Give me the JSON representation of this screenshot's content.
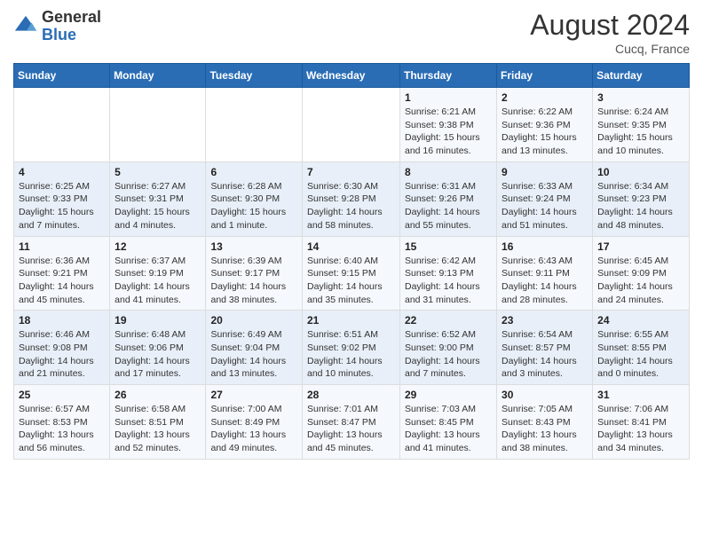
{
  "header": {
    "logo_general": "General",
    "logo_blue": "Blue",
    "month_title": "August 2024",
    "location": "Cucq, France"
  },
  "days_of_week": [
    "Sunday",
    "Monday",
    "Tuesday",
    "Wednesday",
    "Thursday",
    "Friday",
    "Saturday"
  ],
  "weeks": [
    [
      {
        "day": "",
        "info": ""
      },
      {
        "day": "",
        "info": ""
      },
      {
        "day": "",
        "info": ""
      },
      {
        "day": "",
        "info": ""
      },
      {
        "day": "1",
        "info": "Sunrise: 6:21 AM\nSunset: 9:38 PM\nDaylight: 15 hours and 16 minutes."
      },
      {
        "day": "2",
        "info": "Sunrise: 6:22 AM\nSunset: 9:36 PM\nDaylight: 15 hours and 13 minutes."
      },
      {
        "day": "3",
        "info": "Sunrise: 6:24 AM\nSunset: 9:35 PM\nDaylight: 15 hours and 10 minutes."
      }
    ],
    [
      {
        "day": "4",
        "info": "Sunrise: 6:25 AM\nSunset: 9:33 PM\nDaylight: 15 hours and 7 minutes."
      },
      {
        "day": "5",
        "info": "Sunrise: 6:27 AM\nSunset: 9:31 PM\nDaylight: 15 hours and 4 minutes."
      },
      {
        "day": "6",
        "info": "Sunrise: 6:28 AM\nSunset: 9:30 PM\nDaylight: 15 hours and 1 minute."
      },
      {
        "day": "7",
        "info": "Sunrise: 6:30 AM\nSunset: 9:28 PM\nDaylight: 14 hours and 58 minutes."
      },
      {
        "day": "8",
        "info": "Sunrise: 6:31 AM\nSunset: 9:26 PM\nDaylight: 14 hours and 55 minutes."
      },
      {
        "day": "9",
        "info": "Sunrise: 6:33 AM\nSunset: 9:24 PM\nDaylight: 14 hours and 51 minutes."
      },
      {
        "day": "10",
        "info": "Sunrise: 6:34 AM\nSunset: 9:23 PM\nDaylight: 14 hours and 48 minutes."
      }
    ],
    [
      {
        "day": "11",
        "info": "Sunrise: 6:36 AM\nSunset: 9:21 PM\nDaylight: 14 hours and 45 minutes."
      },
      {
        "day": "12",
        "info": "Sunrise: 6:37 AM\nSunset: 9:19 PM\nDaylight: 14 hours and 41 minutes."
      },
      {
        "day": "13",
        "info": "Sunrise: 6:39 AM\nSunset: 9:17 PM\nDaylight: 14 hours and 38 minutes."
      },
      {
        "day": "14",
        "info": "Sunrise: 6:40 AM\nSunset: 9:15 PM\nDaylight: 14 hours and 35 minutes."
      },
      {
        "day": "15",
        "info": "Sunrise: 6:42 AM\nSunset: 9:13 PM\nDaylight: 14 hours and 31 minutes."
      },
      {
        "day": "16",
        "info": "Sunrise: 6:43 AM\nSunset: 9:11 PM\nDaylight: 14 hours and 28 minutes."
      },
      {
        "day": "17",
        "info": "Sunrise: 6:45 AM\nSunset: 9:09 PM\nDaylight: 14 hours and 24 minutes."
      }
    ],
    [
      {
        "day": "18",
        "info": "Sunrise: 6:46 AM\nSunset: 9:08 PM\nDaylight: 14 hours and 21 minutes."
      },
      {
        "day": "19",
        "info": "Sunrise: 6:48 AM\nSunset: 9:06 PM\nDaylight: 14 hours and 17 minutes."
      },
      {
        "day": "20",
        "info": "Sunrise: 6:49 AM\nSunset: 9:04 PM\nDaylight: 14 hours and 13 minutes."
      },
      {
        "day": "21",
        "info": "Sunrise: 6:51 AM\nSunset: 9:02 PM\nDaylight: 14 hours and 10 minutes."
      },
      {
        "day": "22",
        "info": "Sunrise: 6:52 AM\nSunset: 9:00 PM\nDaylight: 14 hours and 7 minutes."
      },
      {
        "day": "23",
        "info": "Sunrise: 6:54 AM\nSunset: 8:57 PM\nDaylight: 14 hours and 3 minutes."
      },
      {
        "day": "24",
        "info": "Sunrise: 6:55 AM\nSunset: 8:55 PM\nDaylight: 14 hours and 0 minutes."
      }
    ],
    [
      {
        "day": "25",
        "info": "Sunrise: 6:57 AM\nSunset: 8:53 PM\nDaylight: 13 hours and 56 minutes."
      },
      {
        "day": "26",
        "info": "Sunrise: 6:58 AM\nSunset: 8:51 PM\nDaylight: 13 hours and 52 minutes."
      },
      {
        "day": "27",
        "info": "Sunrise: 7:00 AM\nSunset: 8:49 PM\nDaylight: 13 hours and 49 minutes."
      },
      {
        "day": "28",
        "info": "Sunrise: 7:01 AM\nSunset: 8:47 PM\nDaylight: 13 hours and 45 minutes."
      },
      {
        "day": "29",
        "info": "Sunrise: 7:03 AM\nSunset: 8:45 PM\nDaylight: 13 hours and 41 minutes."
      },
      {
        "day": "30",
        "info": "Sunrise: 7:05 AM\nSunset: 8:43 PM\nDaylight: 13 hours and 38 minutes."
      },
      {
        "day": "31",
        "info": "Sunrise: 7:06 AM\nSunset: 8:41 PM\nDaylight: 13 hours and 34 minutes."
      }
    ]
  ]
}
